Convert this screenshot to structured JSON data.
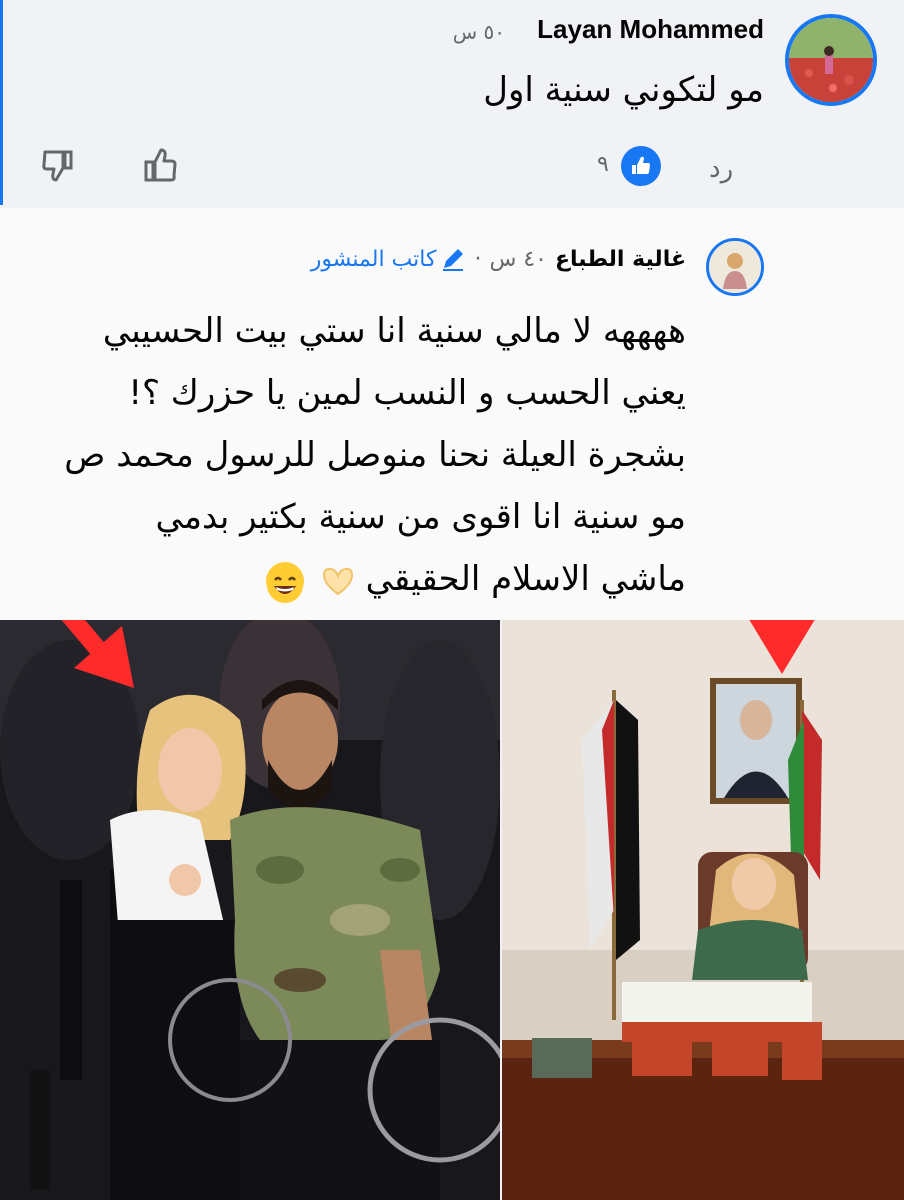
{
  "comment1": {
    "author": "Layan Mohammed",
    "time": "٥٠ س",
    "text": "مو لتكوني سنية اول",
    "reply_label": "رد",
    "like_count": "٩"
  },
  "comment2": {
    "author": "غالية الطباع",
    "time": "٤٠ س",
    "separator": "·",
    "author_badge": "كاتب المنشور",
    "lines": [
      "ههههه لا مالي سنية انا ستي بيت الحسيبي",
      "يعني الحسب و النسب لمين يا حزرك ؟!",
      "بشجرة العيلة نحنا منوصل للرسول محمد ص",
      "مو سنية انا اقوى من سنية بكتير بدمي",
      "ماشي الاسلام الحقيقي"
    ]
  },
  "colors": {
    "accent": "#1877f2",
    "arrow": "#ff2b2b",
    "secondary_text": "#65676b"
  },
  "icons": [
    "dislike-icon",
    "like-icon",
    "like-reaction-icon",
    "pencil-icon",
    "grinning-emoji-icon",
    "heart-hands-emoji-icon"
  ]
}
